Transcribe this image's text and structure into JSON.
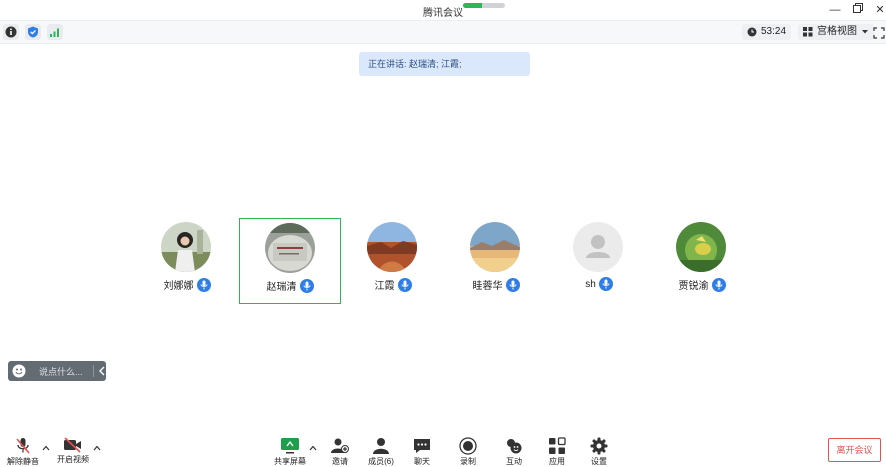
{
  "window": {
    "title": "腾讯会议",
    "network_signal_level": 0.45
  },
  "toolbar": {
    "timer": "53:24",
    "view_label": "宫格视图"
  },
  "speaking_banner": "正在讲话: 赵瑞清; 江霞;",
  "participants": [
    {
      "name": "刘娜娜"
    },
    {
      "name": "赵瑞清"
    },
    {
      "name": "江霞"
    },
    {
      "name": "眭蓉华"
    },
    {
      "name": "sh"
    },
    {
      "name": "贾锐渝"
    }
  ],
  "chat": {
    "placeholder": "说点什么..."
  },
  "controls": {
    "unmute": "解除静音",
    "start_video": "开启视频",
    "share_screen": "共享屏幕",
    "invite": "邀请",
    "members": "成员(6)",
    "chat": "聊天",
    "record": "录制",
    "interact": "互动",
    "apps": "应用",
    "settings": "设置",
    "leave": "离开会议"
  },
  "colors": {
    "active_border": "#2fb457",
    "mic_badge": "#2f7ee8",
    "leave": "#e35151",
    "banner_bg": "#dbe8fb"
  }
}
